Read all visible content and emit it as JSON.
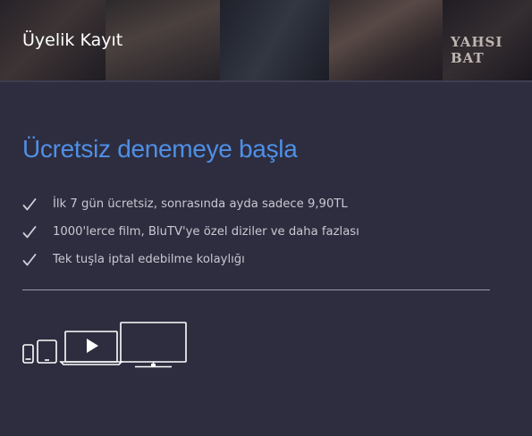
{
  "header": {
    "title": "Üyelik Kayıt",
    "poster_text": "YAHSI BAT"
  },
  "headline": "Ücretsiz denemeye başla",
  "features": [
    {
      "icon": "check-icon",
      "text": "İlk 7 gün ücretsiz, sonrasında ayda sadece 9,90TL"
    },
    {
      "icon": "check-icon",
      "text": "1000'lerce film, BluTV'ye özel diziler ve daha fazlası"
    },
    {
      "icon": "check-icon",
      "text": "Tek tuşla iptal edebilme kolaylığı"
    }
  ],
  "devices": [
    "phone-icon",
    "tablet-icon",
    "laptop-icon",
    "tv-icon"
  ],
  "colors": {
    "background": "#2d2d3f",
    "accent": "#4f8fe6",
    "text": "#c8c8d2",
    "title": "#ffffff"
  }
}
